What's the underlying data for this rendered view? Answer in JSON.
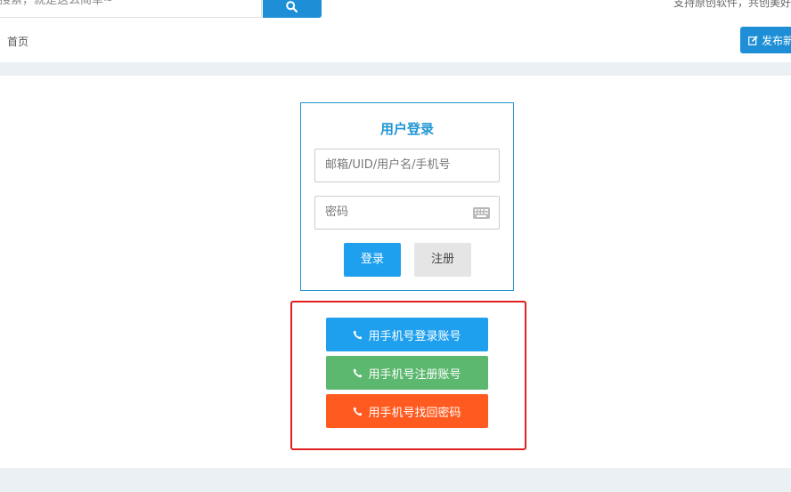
{
  "header": {
    "search_placeholder": "搜索，就是这么简单~",
    "slogan": "支持原创软件，共创美好",
    "publish_label": "发布新"
  },
  "breadcrumb": {
    "home": "首页"
  },
  "login": {
    "title": "用户登录",
    "account_placeholder": "邮箱/UID/用户名/手机号",
    "password_placeholder": "密码",
    "login_label": "登录",
    "register_label": "注册"
  },
  "phone_actions": {
    "login_label": "用手机号登录账号",
    "register_label": "用手机号注册账号",
    "recover_label": "用手机号找回密码"
  },
  "colors": {
    "primary": "#1ea0ee",
    "success": "#5cb86f",
    "danger": "#ff5a1f",
    "highlight": "#e02020"
  }
}
